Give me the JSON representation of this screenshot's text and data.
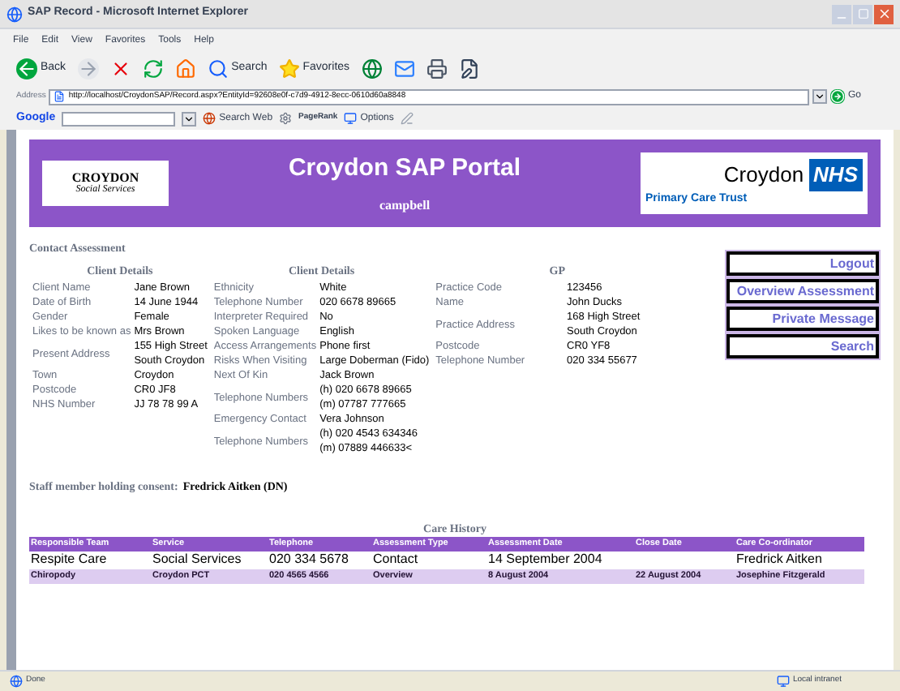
{
  "window": {
    "title": "SAP Record - Microsoft Internet Explorer"
  },
  "menu": [
    "File",
    "Edit",
    "View",
    "Favorites",
    "Tools",
    "Help"
  ],
  "toolbar": [
    {
      "kind": "back",
      "label": "Back"
    },
    {
      "kind": "forward"
    },
    {
      "kind": "stop"
    },
    {
      "kind": "refresh"
    },
    {
      "kind": "home"
    },
    {
      "kind": "search",
      "label": "Search"
    },
    {
      "kind": "favorites",
      "label": "Favorites"
    },
    {
      "kind": "media"
    },
    {
      "kind": "mail"
    },
    {
      "kind": "print"
    },
    {
      "kind": "edit"
    }
  ],
  "address": {
    "label": "Address",
    "value": "http://localhost/CroydonSAP/Record.aspx?EntityId=92608e0f-c7d9-4912-8ecc-0610d60a8848",
    "go": "Go"
  },
  "google_bar": {
    "logo": "Google",
    "search_web": "Search Web",
    "pagerank": "PageRank",
    "options": "Options"
  },
  "banner": {
    "left_logo": [
      "CROYDON",
      "Social Services"
    ],
    "title": "Croydon SAP Portal",
    "user": "campbell",
    "nhs": {
      "name": "Croydon",
      "badge": "NHS",
      "subtitle": "Primary Care Trust"
    }
  },
  "section_title": "Contact Assessment",
  "columns": [
    {
      "heading": "Client Details",
      "rows": [
        {
          "label": "Client Name",
          "lines": [
            "Jane Brown"
          ]
        },
        {
          "label": "Date of Birth",
          "lines": [
            "14 June 1944"
          ]
        },
        {
          "label": "Gender",
          "lines": [
            "Female"
          ]
        },
        {
          "label": "Likes to be known as",
          "lines": [
            "Mrs Brown"
          ]
        },
        {
          "label": "Present Address",
          "lines": [
            "155 High Street",
            "South Croydon"
          ]
        },
        {
          "label": "Town",
          "lines": [
            "Croydon"
          ]
        },
        {
          "label": "Postcode",
          "lines": [
            "CR0 JF8"
          ]
        },
        {
          "label": "NHS Number",
          "lines": [
            "JJ 78 78 99 A"
          ]
        }
      ]
    },
    {
      "heading": "Client Details",
      "rows": [
        {
          "label": "Ethnicity",
          "lines": [
            "White"
          ]
        },
        {
          "label": "Telephone Number",
          "lines": [
            "020 6678 89665"
          ]
        },
        {
          "label": "Interpreter Required",
          "lines": [
            "No"
          ]
        },
        {
          "label": "Spoken Language",
          "lines": [
            "English"
          ]
        },
        {
          "label": "Access Arrangements",
          "lines": [
            "Phone first"
          ]
        },
        {
          "label": "Risks When Visiting",
          "lines": [
            "Large Doberman (Fido)"
          ]
        },
        {
          "label": "Next Of Kin",
          "lines": [
            "Jack Brown"
          ]
        },
        {
          "label": "Telephone Numbers",
          "lines": [
            "(h) 020 6678 89665",
            "(m) 07787 777665"
          ]
        },
        {
          "label": "Emergency Contact",
          "lines": [
            "Vera Johnson"
          ]
        },
        {
          "label": "Telephone Numbers",
          "lines": [
            "(h) 020 4543 634346",
            "(m) 07889 446633<"
          ]
        }
      ]
    },
    {
      "heading": "GP",
      "rows": [
        {
          "label": "Practice Code",
          "lines": [
            "123456"
          ]
        },
        {
          "label": "Name",
          "lines": [
            "John Ducks"
          ]
        },
        {
          "label": "Practice Address",
          "lines": [
            "168 High Street",
            "South Croydon"
          ]
        },
        {
          "label": "Postcode",
          "lines": [
            "CR0 YF8"
          ]
        },
        {
          "label": "Telephone Number",
          "lines": [
            "020 334 55677"
          ]
        }
      ]
    }
  ],
  "actions": [
    "Logout",
    "Overview Assessment",
    "Private Message",
    "Search"
  ],
  "consent": {
    "label": "Staff member holding consent:",
    "value": "Fredrick Aitken (DN)"
  },
  "care_history": {
    "title": "Care History",
    "columns": [
      "Responsible Team",
      "Service",
      "Telephone",
      "Assessment Type",
      "Assessment Date",
      "Close Date",
      "Care Co-ordinator"
    ],
    "rows": [
      {
        "kind": "plain",
        "cells": [
          "Respite Care",
          "Social Services",
          "020 334 5678",
          "Contact",
          "14 September 2004",
          "",
          "Fredrick Aitken"
        ]
      },
      {
        "kind": "highlight",
        "cells": [
          "Chiropody",
          "Croydon PCT",
          "020 4565 4566",
          "Overview",
          "8 August 2004",
          "22 August 2004",
          "Josephine Fitzgerald"
        ]
      }
    ]
  },
  "status_bar": {
    "left": "Done",
    "right": "Local intranet"
  }
}
